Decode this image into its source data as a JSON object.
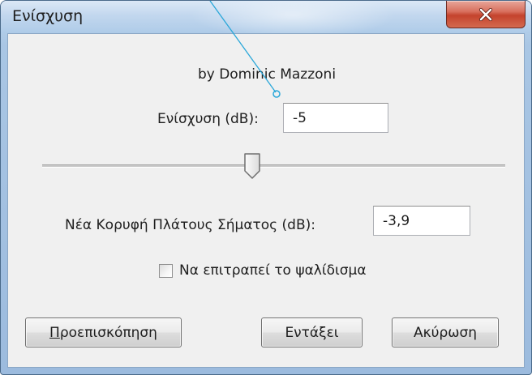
{
  "window": {
    "title": "Ενίσχυση"
  },
  "icons": {
    "close": "close-x-icon",
    "thumb": "slider-thumb-icon"
  },
  "dialog": {
    "author": "by Dominic Mazzoni",
    "amplify_label": "Ενίσχυση (dB):",
    "amplify_value": "-5",
    "slider_value_db": -5,
    "peak_label": "Νέα Κορυφή Πλάτους Σήματος (dB):",
    "peak_value": "-3,9",
    "clipping_label": "Να επιτραπεί το ψαλίδισμα",
    "clipping_checked": false
  },
  "buttons": {
    "preview_first": "Π",
    "preview_rest": "ροεπισκόπηση",
    "ok": "Εντάξει",
    "cancel": "Ακύρωση"
  },
  "colors": {
    "title_bar": "#b5cfe9",
    "close_button": "#c4432d",
    "pointer_line": "#2aa7d9"
  }
}
